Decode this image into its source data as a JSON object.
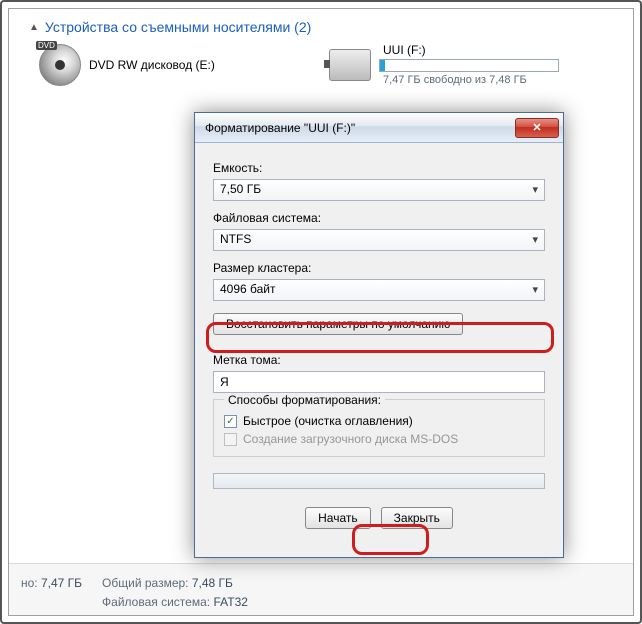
{
  "section": {
    "header": "Устройства со съемными носителями (2)"
  },
  "drives": {
    "dvd": {
      "label": "DVD RW дисковод (E:)",
      "mini": "DVD"
    },
    "usb": {
      "name": "UUI (F:)",
      "info": "7,47 ГБ свободно из 7,48 ГБ"
    }
  },
  "status": {
    "free_label": "но:",
    "free_value": "7,47 ГБ",
    "total_label": "Общий размер:",
    "total_value": "7,48 ГБ",
    "fs_label": "Файловая система:",
    "fs_value": "FAT32"
  },
  "dialog": {
    "title": "Форматирование \"UUI (F:)\"",
    "close": "✕",
    "capacity_label": "Емкость:",
    "capacity_value": "7,50 ГБ",
    "fs_label": "Файловая система:",
    "fs_value": "NTFS",
    "cluster_label": "Размер кластера:",
    "cluster_value": "4096 байт",
    "restore_btn": "Восстановить параметры по умолчанию",
    "volume_label": "Метка тома:",
    "volume_value": "Я",
    "options_legend": "Способы форматирования:",
    "quick_format": "Быстрое (очистка оглавления)",
    "msdos_boot": "Создание загрузочного диска MS-DOS",
    "start_btn": "Начать",
    "close_btn": "Закрыть"
  }
}
